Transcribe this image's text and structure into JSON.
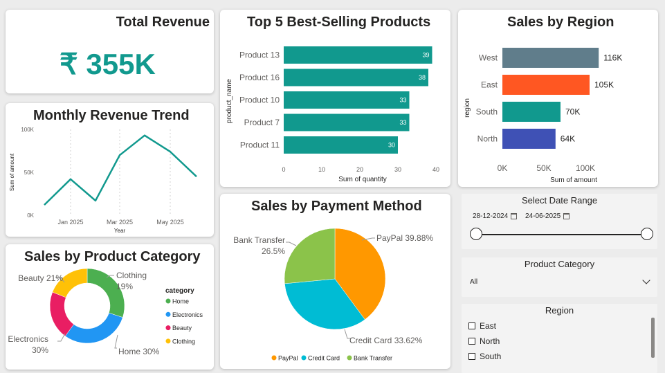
{
  "kpi": {
    "title": "Total Revenue",
    "value": "₹ 355K"
  },
  "slicers": {
    "date": {
      "title": "Select Date Range",
      "start": "28-12-2024",
      "end": "24-06-2025"
    },
    "category": {
      "title": "Product Category",
      "value": "All"
    },
    "region": {
      "title": "Region",
      "items": [
        "East",
        "North",
        "South"
      ]
    }
  },
  "chart_data": [
    {
      "id": "top_products",
      "type": "bar",
      "orientation": "horizontal",
      "title": "Top 5 Best-Selling Products",
      "xlabel": "Sum of quantity",
      "ylabel": "product_name",
      "categories": [
        "Product 13",
        "Product 16",
        "Product 10",
        "Product 7",
        "Product 11"
      ],
      "values": [
        39,
        38,
        33,
        33,
        30
      ],
      "xlim": [
        0,
        40
      ],
      "xticks": [
        "0",
        "10",
        "20",
        "30",
        "40"
      ],
      "color": "#11998e"
    },
    {
      "id": "sales_by_region",
      "type": "bar",
      "orientation": "horizontal",
      "title": "Sales by Region",
      "xlabel": "Sum of amount",
      "ylabel": "region",
      "categories": [
        "West",
        "East",
        "South",
        "North"
      ],
      "values": [
        116,
        105,
        70,
        64
      ],
      "data_labels": [
        "116K",
        "105K",
        "70K",
        "64K"
      ],
      "colors": [
        "#607d8b",
        "#ff5722",
        "#11998e",
        "#3f51b5"
      ],
      "xlim": [
        0,
        130
      ],
      "xticks": [
        "0K",
        "50K",
        "100K"
      ]
    },
    {
      "id": "monthly_revenue",
      "type": "line",
      "title": "Monthly Revenue Trend",
      "xlabel": "Year",
      "ylabel": "Sum of amount",
      "x": [
        "Dec 2024",
        "Jan 2025",
        "Feb 2025",
        "Mar 2025",
        "Apr 2025",
        "May 2025",
        "Jun 2025"
      ],
      "values": [
        12,
        42,
        17,
        70,
        93,
        74,
        45
      ],
      "ylim": [
        0,
        100
      ],
      "yticks": [
        "0K",
        "50K",
        "100K"
      ],
      "xticks": [
        "Jan 2025",
        "Mar 2025",
        "May 2025"
      ],
      "color": "#11998e"
    },
    {
      "id": "payment_method",
      "type": "pie",
      "title": "Sales by Payment Method",
      "categories": [
        "PayPal",
        "Credit Card",
        "Bank Transfer"
      ],
      "values": [
        39.88,
        33.62,
        26.5
      ],
      "slice_labels": [
        "PayPal 39.88%",
        "Credit Card 33.62%",
        "Bank Transfer",
        "26.5%"
      ],
      "colors": [
        "#ff9800",
        "#00bcd4",
        "#8bc34a"
      ]
    },
    {
      "id": "product_category",
      "type": "pie",
      "variant": "donut",
      "title": "Sales by Product Category",
      "legend_title": "category",
      "categories": [
        "Home",
        "Electronics",
        "Beauty",
        "Clothing"
      ],
      "values": [
        30,
        30,
        21,
        19
      ],
      "slice_labels": [
        "Home 30%",
        "Electronics",
        "30%",
        "Beauty 21%",
        "Clothing",
        "19%"
      ],
      "colors": [
        "#4caf50",
        "#2196f3",
        "#e91e63",
        "#ffc107"
      ]
    }
  ]
}
